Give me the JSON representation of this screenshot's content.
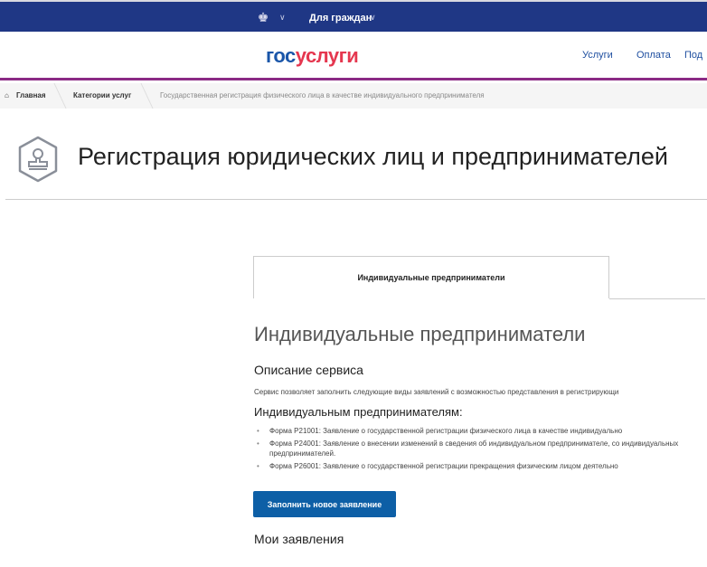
{
  "topbar": {
    "audience": "Для граждан"
  },
  "header": {
    "logo_part1": "гос",
    "logo_part2": "услуги",
    "nav": [
      "Услуги",
      "Оплата",
      "Под"
    ]
  },
  "breadcrumb": {
    "home": "Главная",
    "categories": "Категории услуг",
    "current": "Государственная регистрация физического лица в качестве индивидуального предпринимателя"
  },
  "page": {
    "title": "Регистрация юридических лиц и предпринимателей"
  },
  "tabs": [
    {
      "label": "Индивидуальные предприниматели"
    }
  ],
  "content": {
    "heading": "Индивидуальные предприниматели",
    "desc_title": "Описание сервиса",
    "desc_text": "Сервис позволяет заполнить следующие виды заявлений с возможностью представления в регистрирующи",
    "subheading": "Индивидуальным предпринимателям:",
    "items": [
      "Форма Р21001: Заявление о государственной регистрации физического лица в качестве индивидуально",
      "Форма Р24001: Заявление о внесении изменений в сведения об индивидуальном предпринимателе, со",
      "индивидуальных предпринимателей.",
      "Форма Р26001: Заявление о государственной регистрации прекращения физическим лицом деятельно"
    ],
    "button": "Заполнить новое заявление",
    "my_apps": "Мои заявления"
  }
}
